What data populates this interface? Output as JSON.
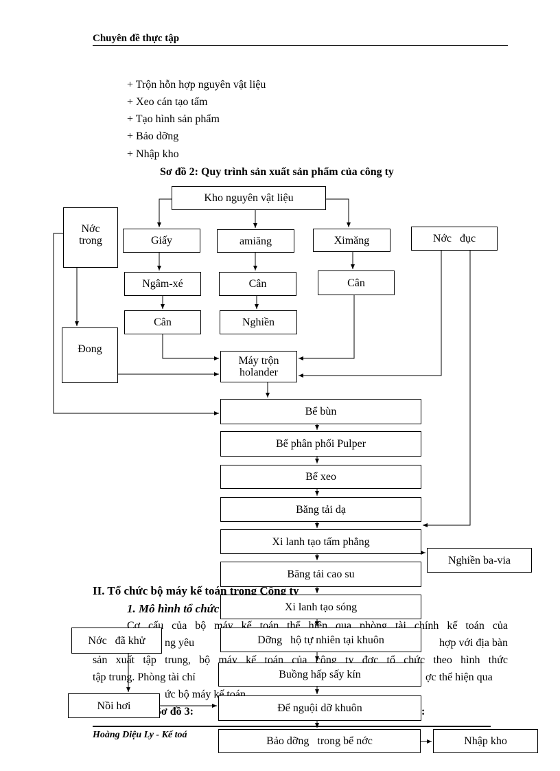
{
  "header": "Chuyên đề thực tập",
  "bullets": [
    "+ Trộn hỗn hợp nguyên vật liệu",
    "+ Xeo cán tạo tấm",
    "+ Tạo hình sản phẩm",
    "+ Bảo dỡng",
    "+ Nhập kho"
  ],
  "diagram_title": "Sơ đồ 2: Quy trình sản xuất sản phẩm của công ty",
  "diagram": {
    "kho": "Kho nguyên vật liệu",
    "nuoc_trong": "Nớc trong",
    "giay": "Giấy",
    "amiang": "amiăng",
    "ximang": "Ximăng",
    "nuoc_duc": "Nớc   đục",
    "ngam": "Ngâm-xé",
    "can1": "Cân",
    "can2": "Cân",
    "can3": "Cân",
    "nghien": "Nghiền",
    "dong": "Đong",
    "may_tron": "Máy trộn holander",
    "be_bun": "Bể bùn",
    "be_phan_phoi": "Bể phân phối Pulper",
    "be_xeo": "Bể xeo",
    "bang_tai_da": "Băng tải dạ",
    "xi_lanh_phang": "Xi lanh tạo tấm phẳng",
    "nghien_bavia": "Nghiền ba-via",
    "bang_tai_cao_su": "Băng tải cao su",
    "xi_lanh_song": "Xi lanh tạo sóng",
    "nuoc_da_khu": "Nớc   đã khử",
    "dong_ho": "Dỡng   hộ tự nhiên tại khuôn",
    "buong_hap": "Buồng hấp sấy kín",
    "noi_hoi": "Nồi hơi",
    "de_nguoi": "Để nguội dỡ khuôn",
    "bao_duong": "Bảo dỡng   trong bể nớc",
    "nhap_kho": "Nhập kho"
  },
  "body": {
    "section": "II. Tổ chức bộ máy kế toán trong Công ty",
    "subsection": "1. Mô hình tổ chức",
    "p1": "Cơ cấu của bộ máy kế toán thể hiện qua phòng tài chính kế toán của",
    "p2a": "ng yêu",
    "p2b": "hợp với địa bàn",
    "p3": "sản xuất tập trung, bộ máy kế toán của công ty đợc  tổ chức theo hình thức",
    "p4a": "tập trung. Phòng tài chí",
    "p4b": "ợc   thể hiện qua",
    "p5": "ức bộ máy kế toán",
    "p6a": "Sơ đồ 3:",
    "p6b": ":"
  },
  "footer": "Hoàng Diệu Ly - Kế toá"
}
